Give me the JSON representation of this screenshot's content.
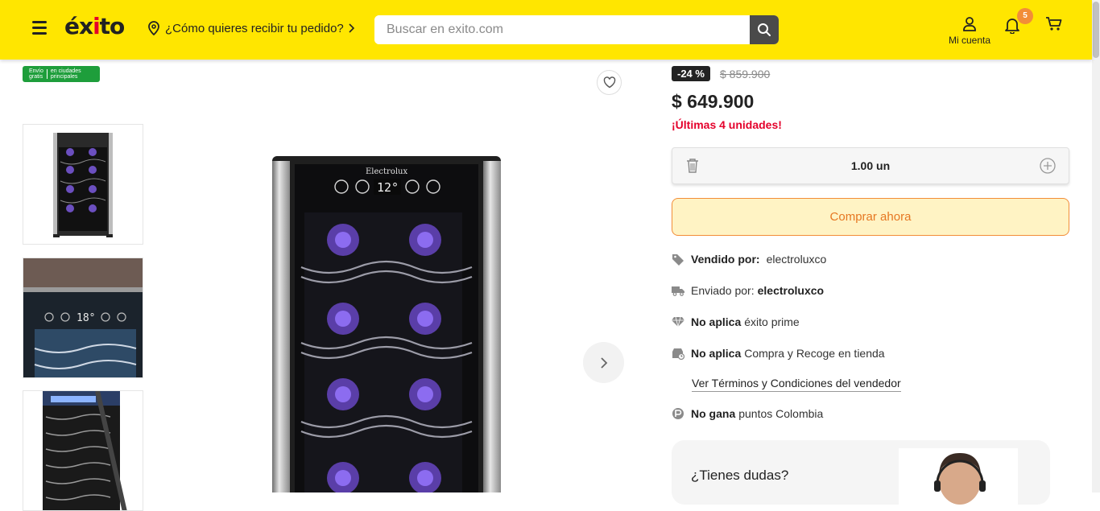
{
  "header": {
    "brand": "éxito",
    "location_prompt": "¿Cómo quieres recibir tu pedido?",
    "search_placeholder": "Buscar en exito.com",
    "account_label": "Mi cuenta",
    "notifications_count": "5",
    "brand_color": "#ffe600"
  },
  "gallery": {
    "shipping_badge": {
      "line1": "Envío",
      "line2": "gratis",
      "line3": "en ciudades",
      "line4": "principales"
    },
    "display_temp_main": "12°",
    "display_temp_thumb": "18°",
    "brand_on_product": "Electrolux"
  },
  "product": {
    "discount": "-24 %",
    "old_price": "$ 859.900",
    "price": "$ 649.900",
    "stock_notice": "¡Últimas 4 unidades!",
    "quantity": "1.00 un",
    "buy_button": "Comprar ahora",
    "sold_by_label": "Vendido por:",
    "sold_by_value": "electroluxco",
    "shipped_by_label": "Enviado por:",
    "shipped_by_value": "electroluxco",
    "prime_bold": "No aplica",
    "prime_text": "éxito prime",
    "pickup_bold": "No aplica",
    "pickup_text": "Compra y Recoge en tienda",
    "terms_link": "Ver Términos y Condiciones del vendedor",
    "points_bold": "No gana",
    "points_text": "puntos Colombia",
    "help_title": "¿Tienes dudas?"
  }
}
